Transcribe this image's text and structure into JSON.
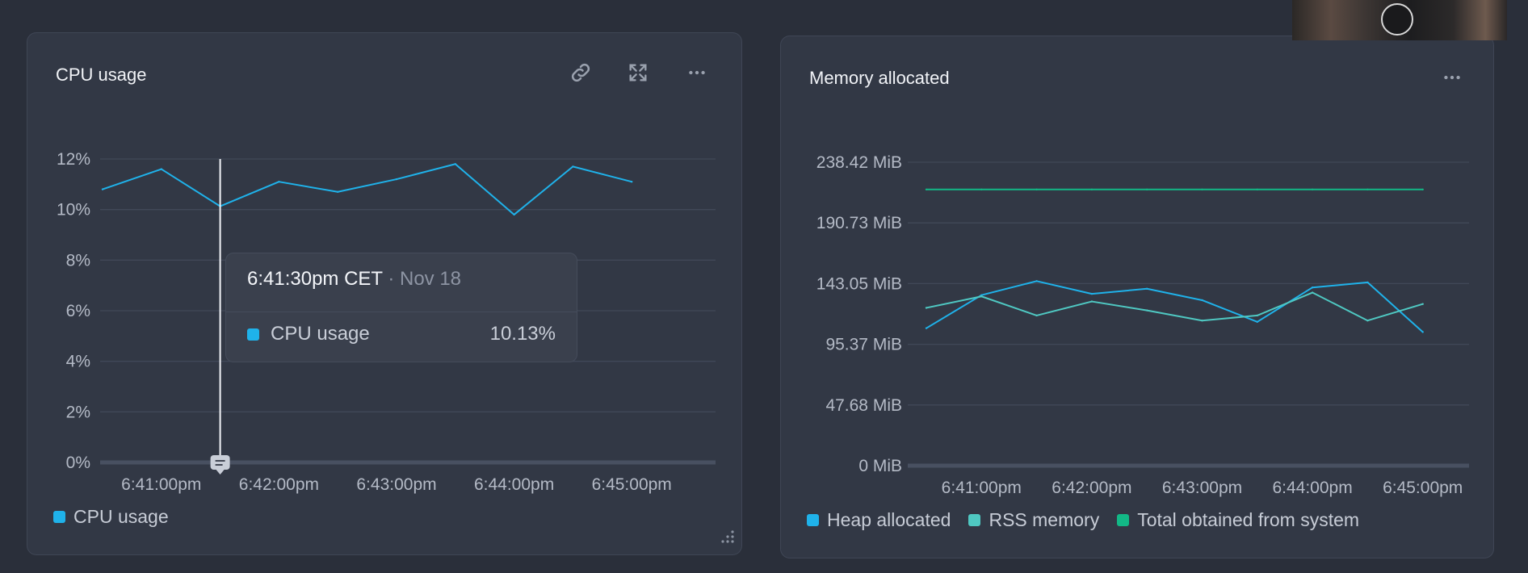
{
  "cpu_panel": {
    "title": "CPU usage",
    "icons": [
      "link-icon",
      "expand-icon",
      "more-icon"
    ],
    "legend": [
      {
        "label": "CPU usage",
        "color": "#1fb2ea"
      }
    ],
    "tooltip": {
      "time": "6:41:30pm CET",
      "date": "· Nov 18",
      "series_label": "CPU usage",
      "value": "10.13%",
      "color": "#1fb2ea"
    }
  },
  "mem_panel": {
    "title": "Memory allocated",
    "icons": [
      "more-icon"
    ],
    "legend": [
      {
        "label": "Heap allocated",
        "color": "#1fb2ea"
      },
      {
        "label": "RSS memory",
        "color": "#4fc8c2"
      },
      {
        "label": "Total obtained from system",
        "color": "#12b886"
      }
    ]
  },
  "chart_data": [
    {
      "type": "line",
      "title": "CPU usage",
      "x_ticks": [
        "6:41:00pm",
        "6:42:00pm",
        "6:43:00pm",
        "6:44:00pm",
        "6:45:00pm"
      ],
      "y_ticks": [
        "0%",
        "2%",
        "4%",
        "6%",
        "8%",
        "10%",
        "12%"
      ],
      "ylim": [
        0,
        12
      ],
      "grid": true,
      "legend_position": "bottom-left",
      "x": [
        "6:40:30pm",
        "6:41:00pm",
        "6:41:30pm",
        "6:42:00pm",
        "6:42:30pm",
        "6:43:00pm",
        "6:43:30pm",
        "6:44:00pm",
        "6:44:30pm",
        "6:45:00pm"
      ],
      "series": [
        {
          "name": "CPU usage",
          "color": "#1fb2ea",
          "values": [
            10.8,
            11.6,
            10.13,
            11.1,
            10.7,
            11.2,
            11.8,
            9.8,
            11.7,
            11.1
          ]
        }
      ]
    },
    {
      "type": "line",
      "title": "Memory allocated",
      "x_ticks": [
        "6:41:00pm",
        "6:42:00pm",
        "6:43:00pm",
        "6:44:00pm",
        "6:45:00pm"
      ],
      "y_ticks": [
        "0 MiB",
        "47.68 MiB",
        "95.37 MiB",
        "143.05 MiB",
        "190.73 MiB",
        "238.42 MiB"
      ],
      "ylim": [
        0,
        238.42
      ],
      "grid": true,
      "legend_position": "bottom-left",
      "x": [
        "6:40:30pm",
        "6:41:00pm",
        "6:41:30pm",
        "6:42:00pm",
        "6:42:30pm",
        "6:43:00pm",
        "6:43:30pm",
        "6:44:00pm",
        "6:44:30pm",
        "6:45:00pm"
      ],
      "series": [
        {
          "name": "Heap allocated",
          "color": "#1fb2ea",
          "values": [
            108,
            134,
            145,
            135,
            139,
            130,
            113,
            140,
            144,
            105
          ]
        },
        {
          "name": "RSS memory",
          "color": "#4fc8c2",
          "values": [
            124,
            133,
            118,
            129,
            122,
            114,
            118,
            136,
            114,
            127
          ]
        },
        {
          "name": "Total obtained from system",
          "color": "#12b886",
          "values": [
            217,
            217,
            217,
            217,
            217,
            217,
            217,
            217,
            217,
            217
          ]
        }
      ]
    }
  ]
}
